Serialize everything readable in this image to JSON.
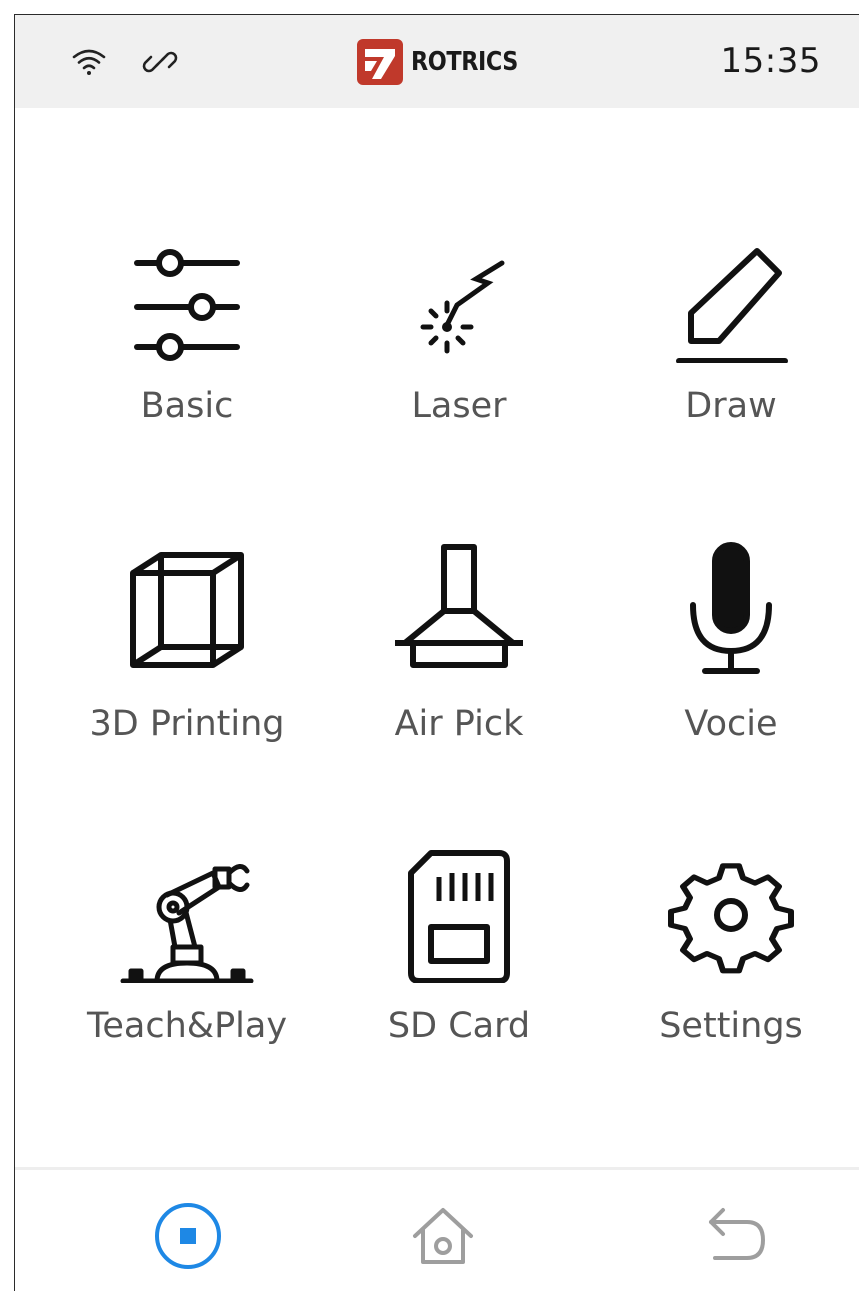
{
  "status_bar": {
    "wifi_icon": "wifi-icon",
    "link_icon": "link-icon",
    "logo": {
      "text": "ROTRICS",
      "color": "#c0392b"
    },
    "time": "15:35"
  },
  "menu": {
    "items": [
      {
        "label": "Basic",
        "icon": "sliders-icon"
      },
      {
        "label": "Laser",
        "icon": "laser-icon"
      },
      {
        "label": "Draw",
        "icon": "pencil-icon"
      },
      {
        "label": "3D Printing",
        "icon": "cube-icon"
      },
      {
        "label": "Air Pick",
        "icon": "suction-hood-icon"
      },
      {
        "label": "Vocie",
        "icon": "microphone-icon"
      },
      {
        "label": "Teach&Play",
        "icon": "robot-arm-icon"
      },
      {
        "label": "SD Card",
        "icon": "sd-card-icon"
      },
      {
        "label": "Settings",
        "icon": "gear-icon"
      }
    ]
  },
  "bottom_nav": {
    "stop": {
      "icon": "stop-icon",
      "color": "#1e88e5"
    },
    "home": {
      "icon": "home-icon",
      "color": "#9e9e9e"
    },
    "back": {
      "icon": "back-arrow-icon",
      "color": "#9e9e9e"
    }
  }
}
